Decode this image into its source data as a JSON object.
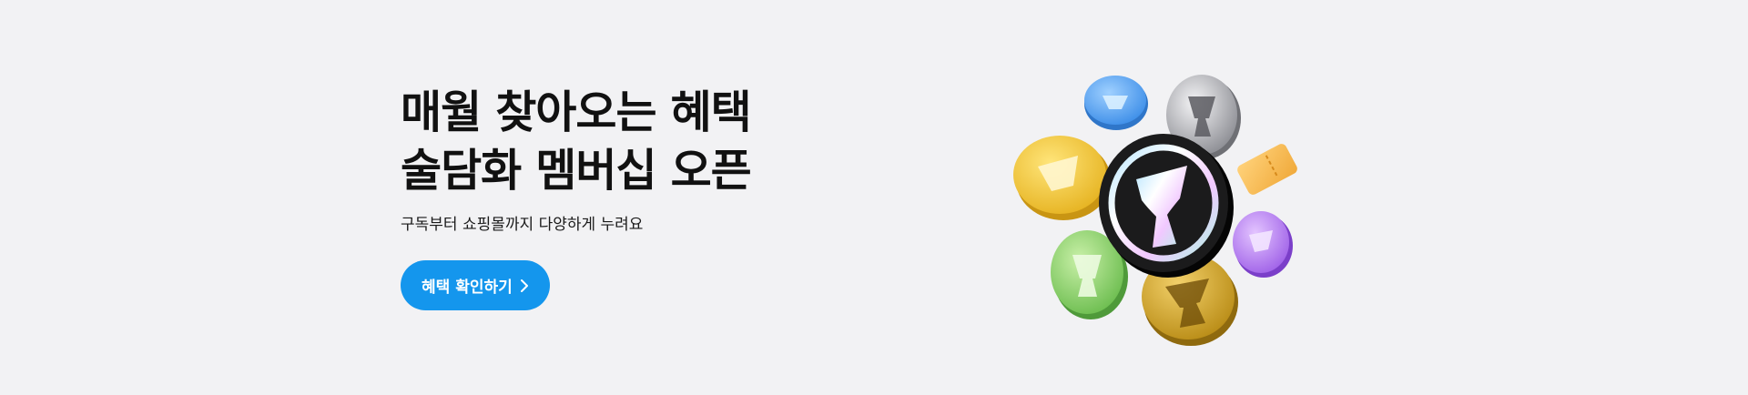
{
  "hero": {
    "headline_line1": "매월 찾아오는 혜택",
    "headline_line2": "술담화 멤버십 오픈",
    "subtitle": "구독부터 쇼핑몰까지 다양하게 누려요",
    "cta_label": "혜택 확인하기"
  },
  "icons": {
    "cta": "chevron-right-icon",
    "illustration": "membership-coins-illustration"
  },
  "colors": {
    "background": "#f2f2f4",
    "cta": "#1496ed",
    "headline": "#111111"
  }
}
